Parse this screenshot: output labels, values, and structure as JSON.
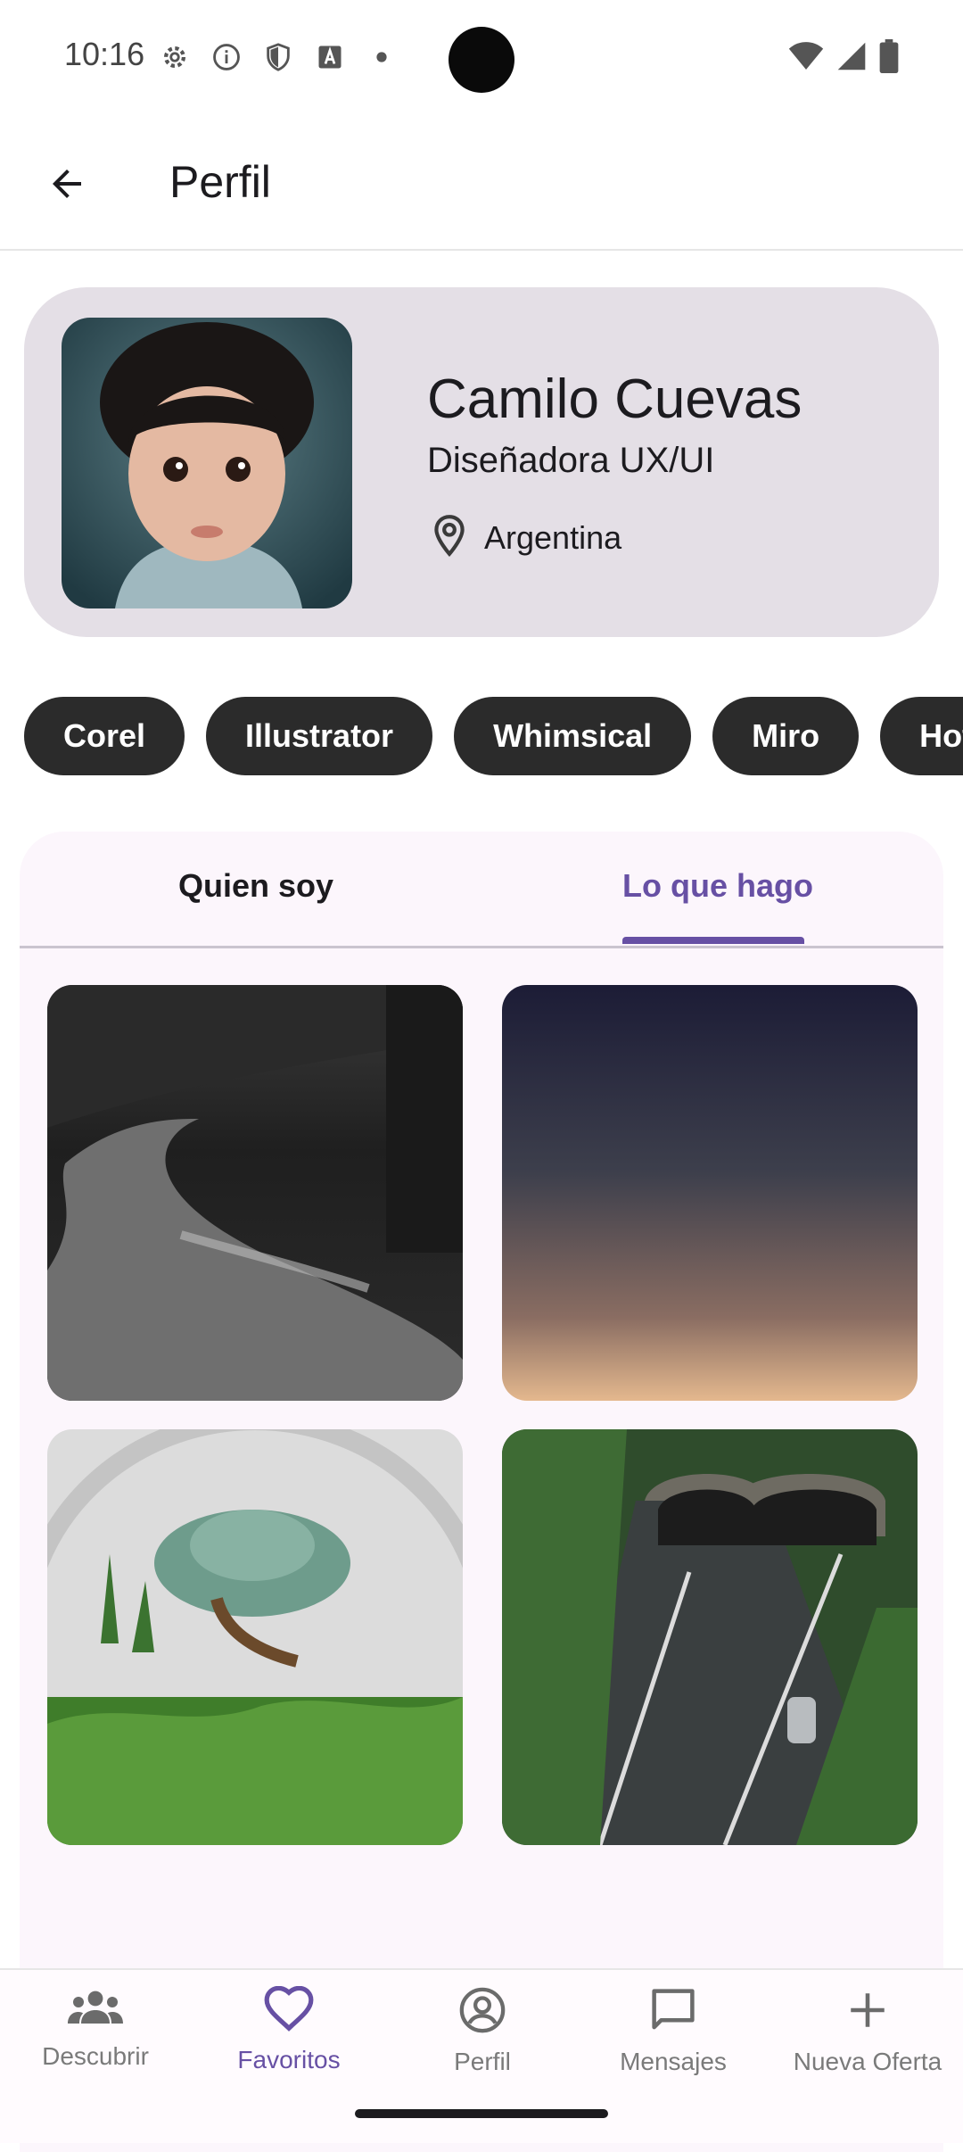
{
  "status_bar": {
    "time": "10:16"
  },
  "app_bar": {
    "title": "Perfil"
  },
  "profile": {
    "name": "Camilo Cuevas",
    "role": "Diseñadora UX/UI",
    "location": "Argentina"
  },
  "skills": [
    "Corel",
    "Illustrator",
    "Whimsical",
    "Miro",
    "Hotj"
  ],
  "tabs": [
    {
      "label": "Quien soy",
      "selected": false
    },
    {
      "label": "Lo que hago",
      "selected": true
    }
  ],
  "bottom_nav": [
    {
      "label": "Descubrir",
      "icon": "people-icon",
      "active": false
    },
    {
      "label": "Favoritos",
      "icon": "heart-icon",
      "active": true
    },
    {
      "label": "Perfil",
      "icon": "account-circle-icon",
      "active": false
    },
    {
      "label": "Mensajes",
      "icon": "message-icon",
      "active": false
    },
    {
      "label": "Nueva Oferta",
      "icon": "plus-icon",
      "active": false
    }
  ],
  "colors": {
    "accent": "#6750a4",
    "card_bg": "#e4dfe6",
    "chip_bg": "#2b2b2b",
    "panel_bg": "#fcf6fc"
  }
}
